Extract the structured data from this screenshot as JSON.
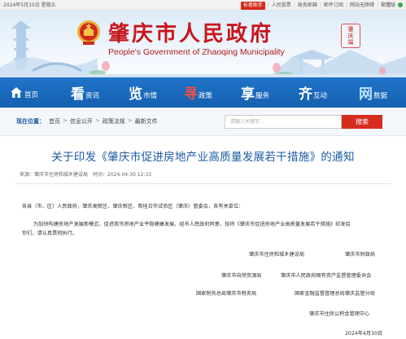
{
  "topbar": {
    "date": "2024年5月10日 星期五",
    "elder_mode": "长者助手",
    "links": [
      "人民投票",
      "政务邮箱",
      "邮件订阅",
      "网站无障碍",
      "繁體版"
    ]
  },
  "banner": {
    "title": "肇庆市人民政府",
    "subtitle": "People's Government of Zhaoqing Municipality",
    "seal_lines": [
      "肇",
      "庆",
      "端"
    ]
  },
  "nav": {
    "items": [
      {
        "big": "",
        "small": "首页"
      },
      {
        "big": "看",
        "small": "资讯"
      },
      {
        "big": "览",
        "small": "市情"
      },
      {
        "big": "寻",
        "small": "政策"
      },
      {
        "big": "享",
        "small": "服务"
      },
      {
        "big": "齐",
        "small": "互动"
      },
      {
        "big": "网",
        "small": "数据"
      }
    ]
  },
  "breadcrumb": {
    "label": "现在位置：",
    "items": [
      "首页",
      "信息公开",
      "政策法规",
      "最新文件"
    ]
  },
  "search": {
    "placeholder": "请输入关键字...",
    "button": "搜索"
  },
  "article": {
    "title": "关于印发《肇庆市促进房地产业高质量发展若干措施》的通知",
    "source": "来源：肇庆市住房和城乡建设局",
    "time": "时间：2024-04-30 12:33",
    "recipients": "各县（市、区）人民政府，肇庆高新区、肇庆新区、粤桂合作试验区（肇庆）管委会，各有关单位：",
    "para_line1": "为加快构建房地产发展新模式，促进我市房地产业平稳健康发展，经市人民政府同意，现将《肇庆市促进房地产业高质量发展若干措施》印发给",
    "para_line2": "你们，请认真贯彻执行。",
    "signatures": [
      {
        "left": "肇庆市住房和城乡建设局",
        "right": "肇庆市财政局"
      },
      {
        "left": "肇庆市自然资源局",
        "right": "肇庆市人民政府国有资产监督管理委员会"
      },
      {
        "left": "国家税务总局肇庆市税务局",
        "right": "国家金融监督管理总局肇庆监管分局"
      },
      {
        "left": "",
        "right": "肇庆市住房公积金管理中心"
      }
    ],
    "date": "2024年4月30日"
  }
}
